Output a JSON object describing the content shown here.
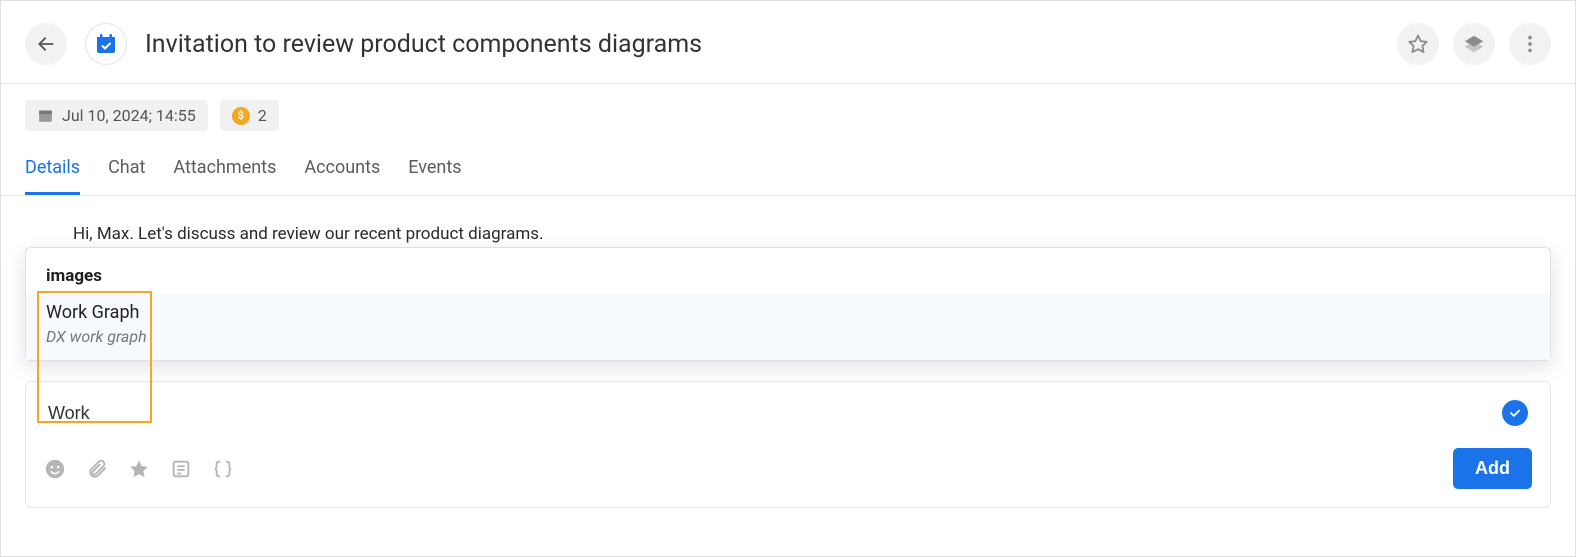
{
  "header": {
    "title": "Invitation to review product components diagrams"
  },
  "meta": {
    "date": "Jul 10, 2024; 14:55",
    "coin_symbol": "$",
    "point_value": "2"
  },
  "tabs": [
    {
      "label": "Details",
      "active": true
    },
    {
      "label": "Chat",
      "active": false
    },
    {
      "label": "Attachments",
      "active": false
    },
    {
      "label": "Accounts",
      "active": false
    },
    {
      "label": "Events",
      "active": false
    }
  ],
  "editor": {
    "line1": "Hi, Max. Let's discuss and review our recent product diagrams."
  },
  "popup": {
    "section": "images",
    "suggestion": {
      "title": "Work Graph",
      "subtitle": "DX work graph"
    }
  },
  "comment": {
    "input_value": "Work",
    "add_label": "Add"
  }
}
